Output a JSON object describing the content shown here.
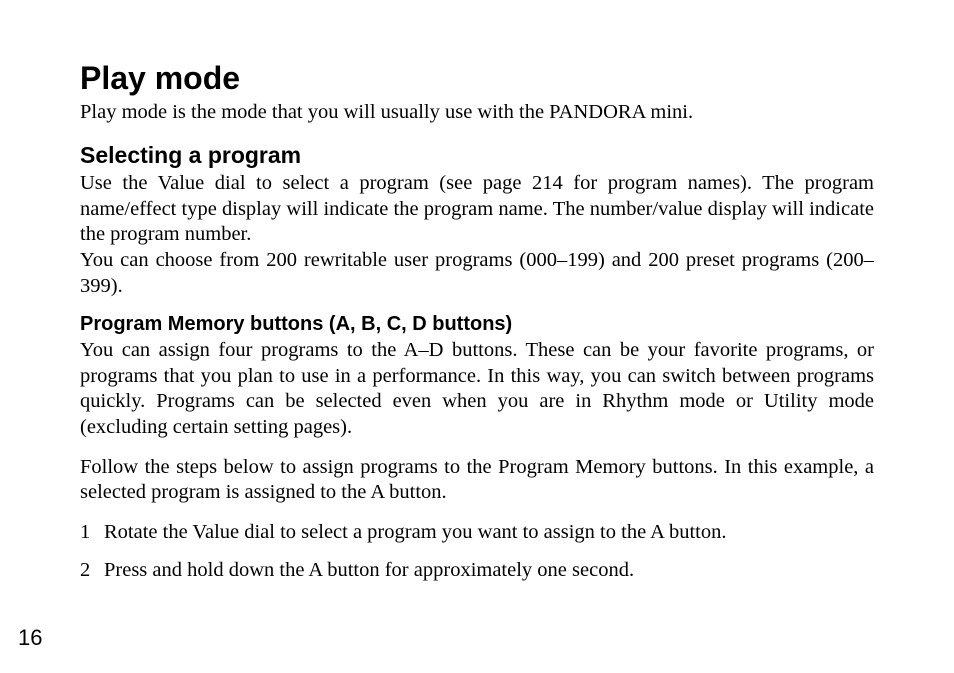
{
  "h1": "Play mode",
  "intro": "Play mode is the mode that you will usually use with the PANDORA mini.",
  "h2": "Selecting a program",
  "selecting_p1": "Use the Value dial to select a program (see page 214 for program names). The program name/effect type display will indicate the program name. The number/value display will indicate the program number.",
  "selecting_p2": "You can choose from 200 rewritable user programs (000–199) and 200 preset programs (200–399).",
  "h3": "Program Memory buttons (A, B, C, D buttons)",
  "pm_p1": "You can assign four programs to the A–D buttons. These can be your favorite programs, or programs that you plan to use in a performance. In this way, you can switch between programs quickly. Programs can be selected even when you are in Rhythm mode or Utility mode (excluding certain setting pages).",
  "pm_p2": "Follow the steps below to assign programs to the Program Memory buttons. In this example, a selected program is assigned to the A button.",
  "steps": [
    {
      "n": "1",
      "t": "Rotate the Value dial to select a program you want to assign to the A button."
    },
    {
      "n": "2",
      "t": "Press and hold down the A button for approximately one second."
    }
  ],
  "page_number": "16"
}
